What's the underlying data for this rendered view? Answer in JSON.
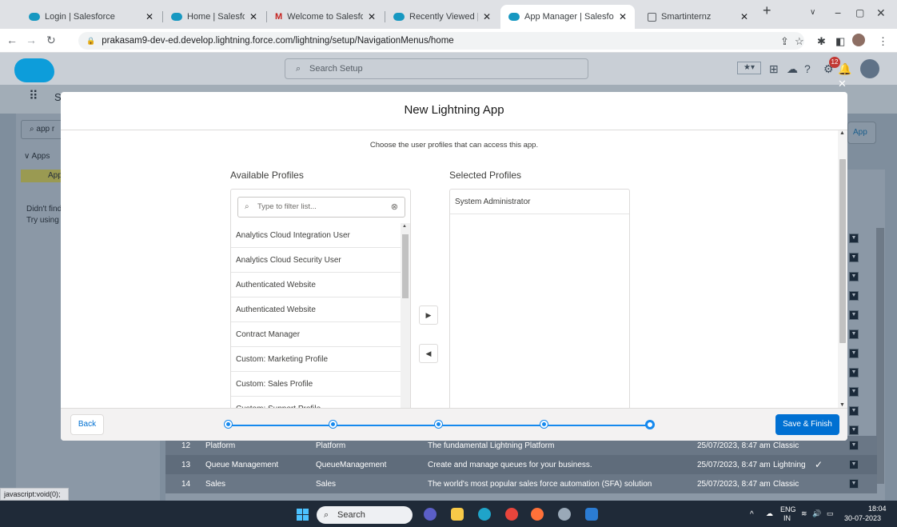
{
  "browser": {
    "tabs": [
      {
        "label": "Login | Salesforce",
        "icon": "salesforce-icon"
      },
      {
        "label": "Home | Salesforce",
        "icon": "salesforce-icon"
      },
      {
        "label": "Welcome to Salesforce: Ver",
        "icon": "gmail-icon"
      },
      {
        "label": "Recently Viewed | Semeste",
        "icon": "salesforce-icon"
      },
      {
        "label": "App Manager | Salesforce",
        "icon": "salesforce-icon"
      },
      {
        "label": "Smartinternz",
        "icon": "smartinternz-icon"
      }
    ],
    "url": "prakasam9-dev-ed.develop.lightning.force.com/lightning/setup/NavigationMenus/home",
    "status_link": "javascript:void(0);"
  },
  "sf": {
    "search_placeholder": "Search Setup",
    "notification_count": "12",
    "side_search": "app r",
    "side_apps": "Apps",
    "side_app_item": "App",
    "side_didnt": "Didn't find",
    "side_try": "Try using G",
    "new_app_btn": "App",
    "nav_app": "S"
  },
  "table": {
    "rows": [
      {
        "num": "12",
        "name": "Platform",
        "dev": "Platform",
        "desc": "The fundamental Lightning Platform",
        "date": "25/07/2023, 8:47 am",
        "type": "Classic",
        "check": ""
      },
      {
        "num": "13",
        "name": "Queue Management",
        "dev": "QueueManagement",
        "desc": "Create and manage queues for your business.",
        "date": "25/07/2023, 8:47 am",
        "type": "Lightning",
        "check": "✓"
      },
      {
        "num": "14",
        "name": "Sales",
        "dev": "Sales",
        "desc": "The world's most popular sales force automation (SFA) solution",
        "date": "25/07/2023, 8:47 am",
        "type": "Classic",
        "check": ""
      }
    ]
  },
  "modal": {
    "title": "New Lightning App",
    "subtitle": "Choose the user profiles that can access this app.",
    "available_title": "Available Profiles",
    "selected_title": "Selected Profiles",
    "filter_placeholder": "Type to filter list...",
    "available": [
      "Analytics Cloud Integration User",
      "Analytics Cloud Security User",
      "Authenticated Website",
      "Authenticated Website",
      "Contract Manager",
      "Custom: Marketing Profile",
      "Custom: Sales Profile",
      "Custom: Support Profile"
    ],
    "selected": [
      "System Administrator"
    ],
    "back_label": "Back",
    "save_label": "Save & Finish",
    "progress_steps": 5,
    "current_step": 5
  },
  "taskbar": {
    "search_label": "Search",
    "lang": "ENG",
    "region": "IN",
    "time": "18:04",
    "date": "30-07-2023"
  }
}
